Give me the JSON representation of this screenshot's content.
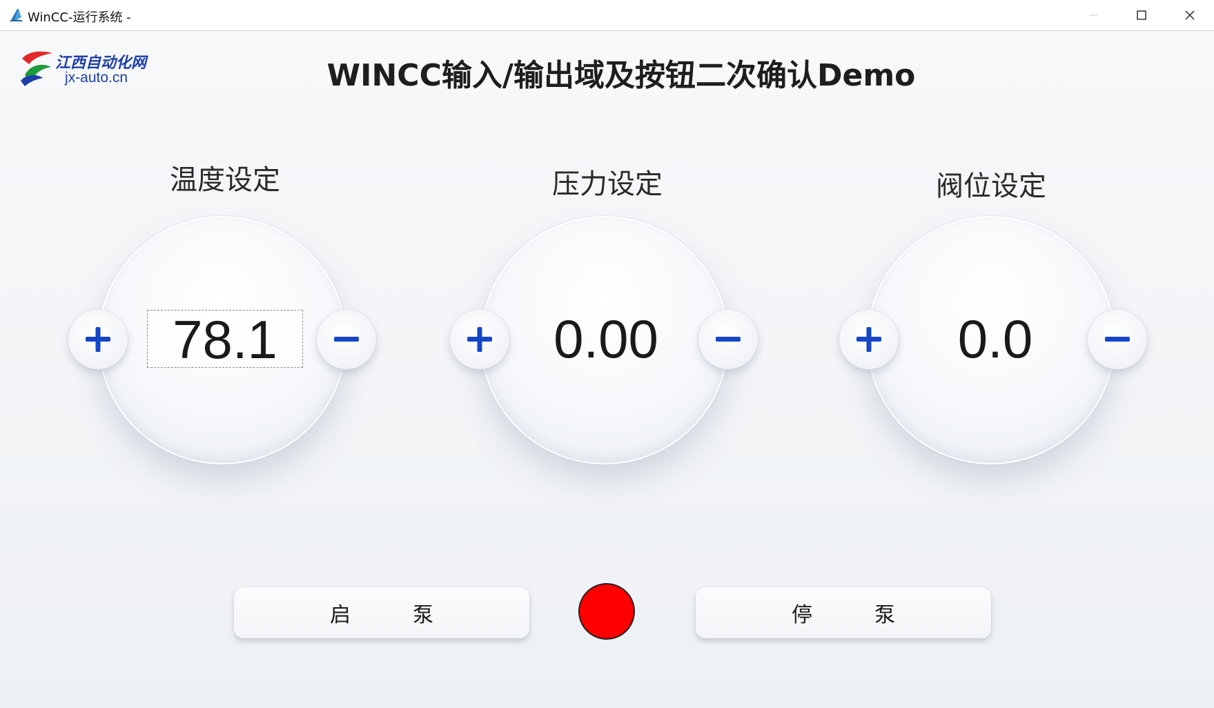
{
  "window": {
    "title": "WinCC-运行系统 -"
  },
  "logo": {
    "text_top": "江西自动化网",
    "text_bottom": "jx-auto.cn"
  },
  "page": {
    "title": "WINCC输入/输出域及按钮二次确认Demo"
  },
  "groups": [
    {
      "label": "温度设定",
      "value": "78.1"
    },
    {
      "label": "压力设定",
      "value": "0.00"
    },
    {
      "label": "阀位设定",
      "value": "0.0"
    }
  ],
  "pump": {
    "start_label": "启　　　泵",
    "stop_label": "停　　　泵",
    "lamp_color": "#ff0000"
  },
  "colors": {
    "accent_blue": "#1546c8"
  }
}
